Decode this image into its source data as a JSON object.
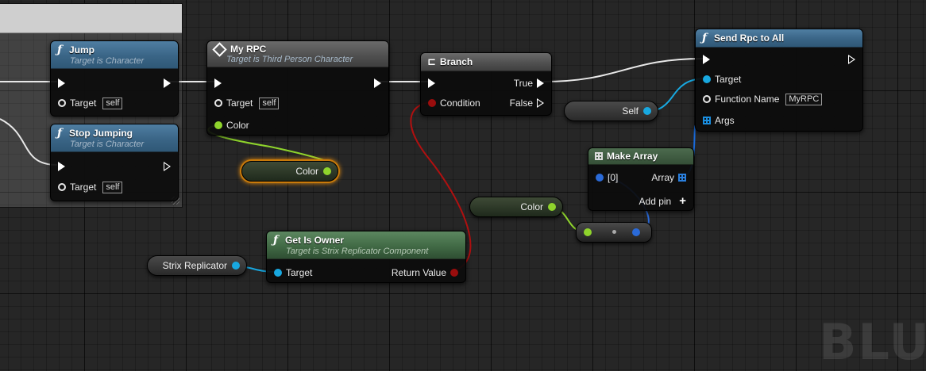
{
  "nodes": {
    "jump": {
      "title": "Jump",
      "subtitle": "Target is Character",
      "target_label": "Target",
      "target_value": "self"
    },
    "stop_jumping": {
      "title": "Stop Jumping",
      "subtitle": "Target is Character",
      "target_label": "Target",
      "target_value": "self"
    },
    "my_rpc": {
      "title": "My RPC",
      "subtitle": "Target is Third Person Character",
      "target_label": "Target",
      "target_value": "self",
      "color_label": "Color"
    },
    "branch": {
      "title": "Branch",
      "true_label": "True",
      "condition_label": "Condition",
      "false_label": "False"
    },
    "send_rpc": {
      "title": "Send Rpc to All",
      "target_label": "Target",
      "function_name_label": "Function Name",
      "function_name_value": "MyRPC",
      "args_label": "Args"
    },
    "make_array": {
      "title": "Make Array",
      "index_label": "[0]",
      "array_label": "Array",
      "add_pin_label": "Add pin"
    },
    "get_is_owner": {
      "title": "Get Is Owner",
      "subtitle": "Target is Strix Replicator Component",
      "target_label": "Target",
      "return_label": "Return Value"
    }
  },
  "variables": {
    "self": "Self",
    "color_selected": "Color",
    "color": "Color",
    "strix_replicator": "Strix Replicator"
  },
  "watermark": "BLU",
  "colors": {
    "exec": "#ffffff",
    "object": "#18a8e0",
    "struct": "#8fd42c",
    "bool": "#9a0d0d",
    "name": "#e026b8",
    "selection": "#e38c10"
  }
}
